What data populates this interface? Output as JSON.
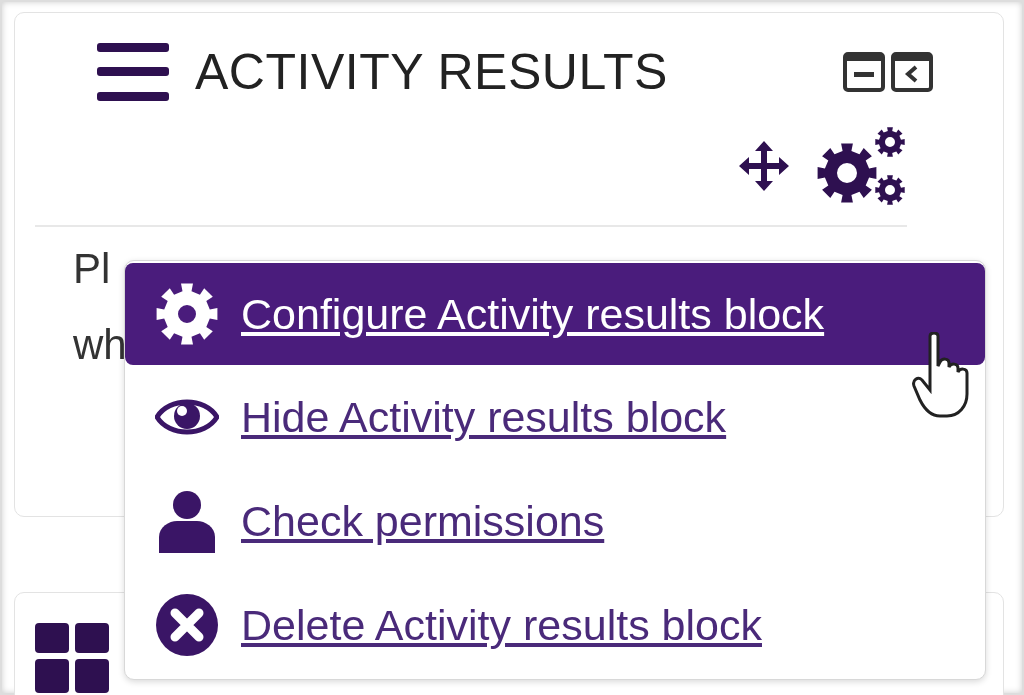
{
  "block": {
    "title": "ACTIVITY RESULTS",
    "body_lines": [
      "Pl",
      "wh"
    ]
  },
  "menu": {
    "items": [
      {
        "kind": "configure",
        "label": "Configure Activity results block",
        "selected": true
      },
      {
        "kind": "hide",
        "label": "Hide Activity results block",
        "selected": false
      },
      {
        "kind": "permissions",
        "label": "Check permissions",
        "selected": false
      },
      {
        "kind": "delete",
        "label": "Delete Activity results block",
        "selected": false
      }
    ]
  }
}
